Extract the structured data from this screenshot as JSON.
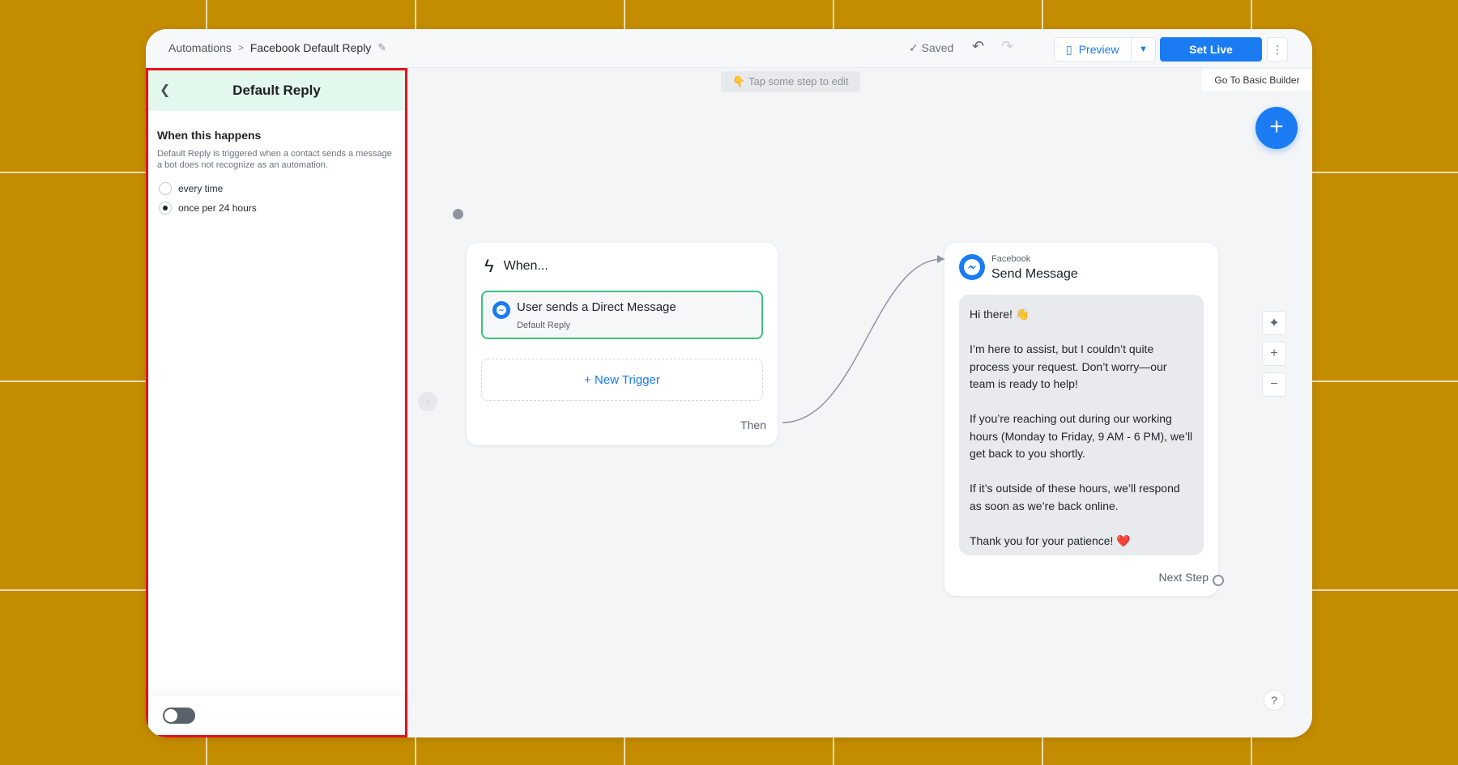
{
  "breadcrumb": {
    "root": "Automations",
    "current": "Facebook Default Reply"
  },
  "status": {
    "saved": "Saved"
  },
  "toolbar": {
    "preview": "Preview",
    "set_live": "Set Live",
    "basic_builder": "Go To Basic Builder"
  },
  "hint": "👇 Tap some step to edit",
  "panel": {
    "title": "Default Reply",
    "section_title": "When this happens",
    "description": "Default Reply is triggered when a contact sends a message a bot does not recognize as an automation.",
    "options": [
      {
        "label": "every time",
        "selected": false
      },
      {
        "label": "once per 24 hours",
        "selected": true
      }
    ],
    "toggle_on": false
  },
  "trigger_card": {
    "heading": "When...",
    "trigger_title": "User sends a Direct Message",
    "trigger_subtitle": "Default Reply",
    "new_trigger": "+ New Trigger",
    "then": "Then"
  },
  "message_card": {
    "platform": "Facebook",
    "title": "Send Message",
    "paragraphs": [
      "Hi there! 👋",
      "I’m here to assist, but I couldn’t quite process your request. Don’t worry—our team is ready to help!",
      "If you’re reaching out during our working hours (Monday to Friday, 9 AM - 6 PM), we’ll get back to you shortly.",
      "If it’s outside of these hours, we’ll respond as soon as we’re back online.",
      "Thank you for your patience! ❤️"
    ],
    "next_step": "Next Step"
  },
  "colors": {
    "accent": "#1a7bf3",
    "success": "#39c47d",
    "highlight": "#e8101e",
    "background": "#c48c00"
  },
  "icons": [
    "back-chevron-icon",
    "pencil-icon",
    "check-icon",
    "undo-icon",
    "redo-icon",
    "document-icon",
    "chevron-down-icon",
    "kebab-icon",
    "plus-icon",
    "magic-wand-icon",
    "zoom-in-icon",
    "zoom-out-icon",
    "help-icon",
    "bolt-icon",
    "messenger-icon"
  ]
}
